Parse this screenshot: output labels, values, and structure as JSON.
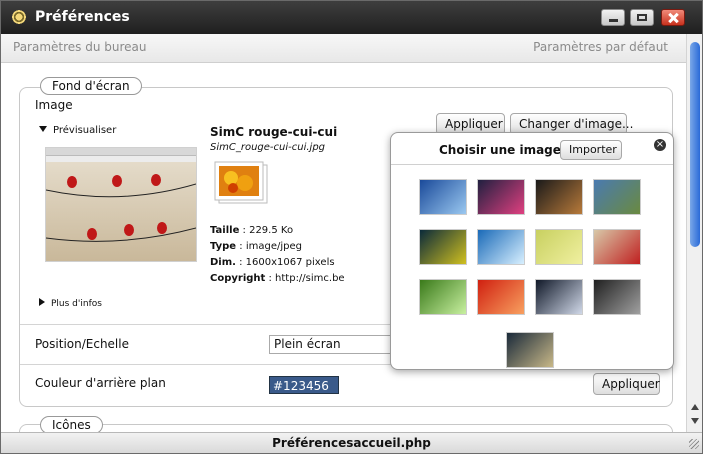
{
  "window": {
    "title": "Préférences"
  },
  "tabs": {
    "left": "Paramètres du bureau",
    "right": "Paramètres par défaut"
  },
  "section_wallpaper": {
    "legend": "Fond d'écran",
    "image_label": "Image",
    "preview_toggle": "Prévisualiser",
    "more_info": "Plus d'infos",
    "apply_label": "Appliquer",
    "change_label": "Changer d'image...",
    "file": {
      "name": "SimC rouge-cui-cui",
      "filename": "SimC_rouge-cui-cui.jpg",
      "size_label": "Taille",
      "size_value": " : 229.5 Ko",
      "type_label": "Type",
      "type_value": " : image/jpeg",
      "dim_label": "Dim.",
      "dim_value": " : 1600x1067 pixels",
      "copyright_label": "Copyright",
      "copyright_value": " : http://simc.be"
    }
  },
  "position": {
    "label": "Position/Echelle",
    "value": "Plein écran"
  },
  "background_color": {
    "label": "Couleur d'arrière plan",
    "value": "#123456",
    "apply_label": "Appliquer"
  },
  "section_icons": {
    "legend": "Icônes"
  },
  "popup": {
    "title": "Choisir une image ou",
    "import_label": "Importer",
    "thumbnails": [
      {
        "name": "blue-sphere",
        "colors": [
          "#1a4a9a",
          "#9ac8f0"
        ]
      },
      {
        "name": "colorful-lines",
        "colors": [
          "#202040",
          "#e04080"
        ]
      },
      {
        "name": "dark-figure",
        "colors": [
          "#1a1a1a",
          "#b87a3a"
        ]
      },
      {
        "name": "lake-landscape",
        "colors": [
          "#4a7ab0",
          "#6a8a40"
        ]
      },
      {
        "name": "green-bubbles",
        "colors": [
          "#0a2a3a",
          "#d0c020"
        ]
      },
      {
        "name": "water-splash",
        "colors": [
          "#1a6ab8",
          "#d8f0ff"
        ]
      },
      {
        "name": "yellow-green",
        "colors": [
          "#c8d060",
          "#f0f0a0"
        ]
      },
      {
        "name": "birds-wall",
        "colors": [
          "#d8c8a8",
          "#c02020"
        ]
      },
      {
        "name": "green-swirl",
        "colors": [
          "#3a7a1a",
          "#c8f0a0"
        ]
      },
      {
        "name": "red-orange",
        "colors": [
          "#d02010",
          "#f8a060"
        ]
      },
      {
        "name": "silver-ring",
        "colors": [
          "#101828",
          "#d0d8e8"
        ]
      },
      {
        "name": "grey-abstract",
        "colors": [
          "#202020",
          "#a0a0a0"
        ]
      },
      {
        "name": "dark-lines",
        "colors": [
          "#1a2a3a",
          "#c8b888"
        ]
      }
    ]
  },
  "status": {
    "text": "Préférencesaccueil.php"
  }
}
